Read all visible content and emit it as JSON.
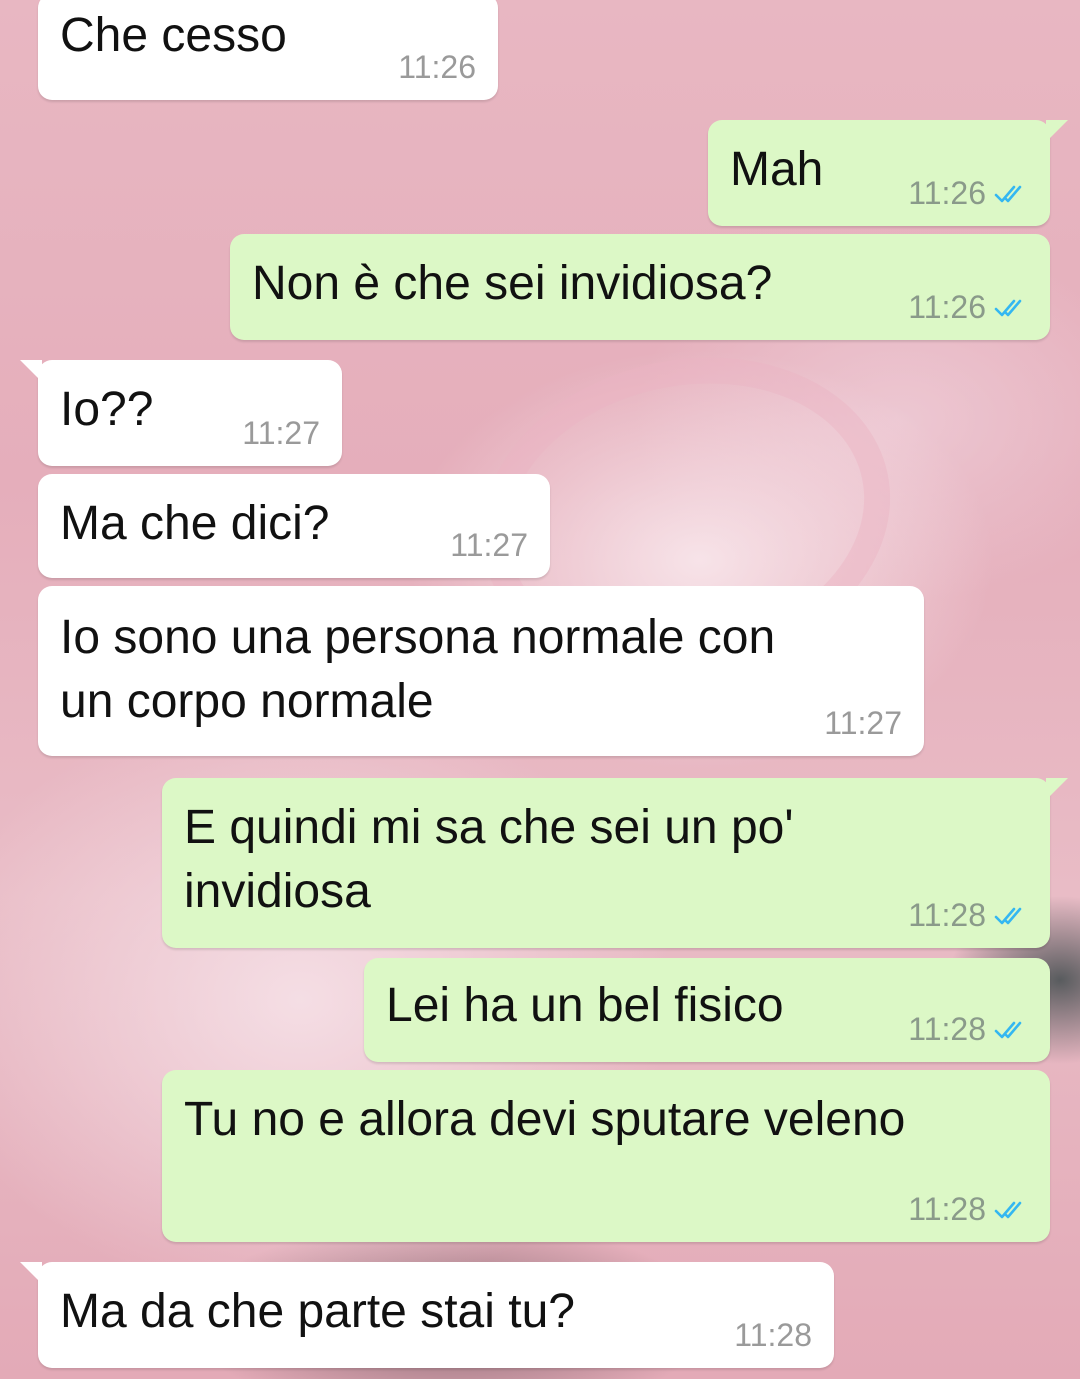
{
  "theme": {
    "incoming_bg": "#ffffff",
    "outgoing_bg": "#dcf8c6",
    "read_tick_color": "#34b7f1"
  },
  "messages": [
    {
      "direction": "incoming",
      "text": "Che cesso",
      "time": "11:26"
    },
    {
      "direction": "outgoing",
      "text": "Mah",
      "time": "11:26",
      "status": "read"
    },
    {
      "direction": "outgoing",
      "text": "Non è che sei invidiosa?",
      "time": "11:26",
      "status": "read"
    },
    {
      "direction": "incoming",
      "text": "Io??",
      "time": "11:27"
    },
    {
      "direction": "incoming",
      "text": "Ma che dici?",
      "time": "11:27"
    },
    {
      "direction": "incoming",
      "text": "Io sono una persona normale con\nun corpo normale",
      "time": "11:27"
    },
    {
      "direction": "outgoing",
      "text": "E quindi mi sa che sei un po'\ninvidiosa",
      "time": "11:28",
      "status": "read"
    },
    {
      "direction": "outgoing",
      "text": "Lei ha un bel fisico",
      "time": "11:28",
      "status": "read"
    },
    {
      "direction": "outgoing",
      "text": "Tu no e allora devi sputare veleno",
      "time": "11:28",
      "status": "read"
    },
    {
      "direction": "incoming",
      "text": "Ma da che parte stai tu?",
      "time": "11:28"
    }
  ]
}
